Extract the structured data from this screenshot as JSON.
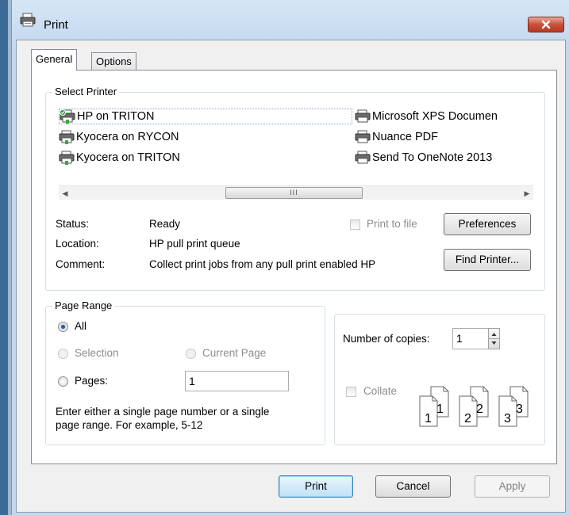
{
  "window": {
    "title": "Print"
  },
  "tabs": [
    {
      "label": "General",
      "active": true
    },
    {
      "label": "Options",
      "active": false
    }
  ],
  "select_printer": {
    "group_label": "Select Printer",
    "printers": [
      {
        "name": "HP on TRITON",
        "selected": true,
        "default": true
      },
      {
        "name": "Kyocera on RYCON"
      },
      {
        "name": "Kyocera on TRITON"
      },
      {
        "name": "Microsoft XPS Documen"
      },
      {
        "name": "Nuance PDF"
      },
      {
        "name": "Send To OneNote 2013"
      }
    ],
    "scrollbar_grip": "III",
    "status_label": "Status:",
    "status_value": "Ready",
    "location_label": "Location:",
    "location_value": "HP pull print queue",
    "comment_label": "Comment:",
    "comment_value": "Collect print jobs from any pull print enabled HP",
    "print_to_file_label": "Print to file",
    "preferences_label": "Preferences",
    "find_printer_label": "Find Printer..."
  },
  "page_range": {
    "group_label": "Page Range",
    "all_label": "All",
    "selection_label": "Selection",
    "current_page_label": "Current Page",
    "pages_label": "Pages:",
    "pages_value": "1",
    "hint_line1": "Enter either a single page number or a single",
    "hint_line2": "page range.  For example, 5-12",
    "selected_option": "All"
  },
  "copies": {
    "label": "Number of copies:",
    "value": "1",
    "collate_label": "Collate",
    "collate_checked": false,
    "collate_pages": [
      "1",
      "1",
      "2",
      "2",
      "3",
      "3"
    ]
  },
  "buttons": {
    "print": "Print",
    "cancel": "Cancel",
    "apply": "Apply"
  },
  "colors": {
    "title_bar": "#c3d8ee",
    "close_button": "#c9503a",
    "default_button_border": "#3c7fb1"
  }
}
